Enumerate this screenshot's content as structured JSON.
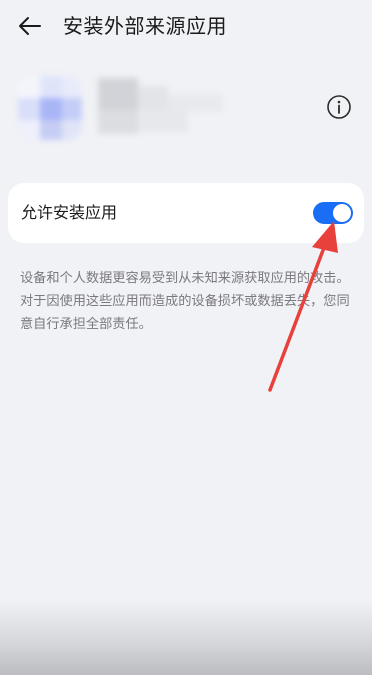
{
  "header": {
    "back_icon": "back-arrow-icon",
    "title": "安装外部来源应用"
  },
  "app": {
    "icon": "blurred-app-icon",
    "info_icon": "info-icon"
  },
  "setting": {
    "label": "允许安装应用",
    "toggle_state": true,
    "toggle_color": "#1a6ef5"
  },
  "description": "设备和个人数据更容易受到从未知来源获取应用的攻击。对于因使用这些应用而造成的设备损坏或数据丢失，您同意自行承担全部责任。",
  "annotation": {
    "type": "red-arrow-pointing-to-toggle",
    "color": "#e8403a"
  }
}
